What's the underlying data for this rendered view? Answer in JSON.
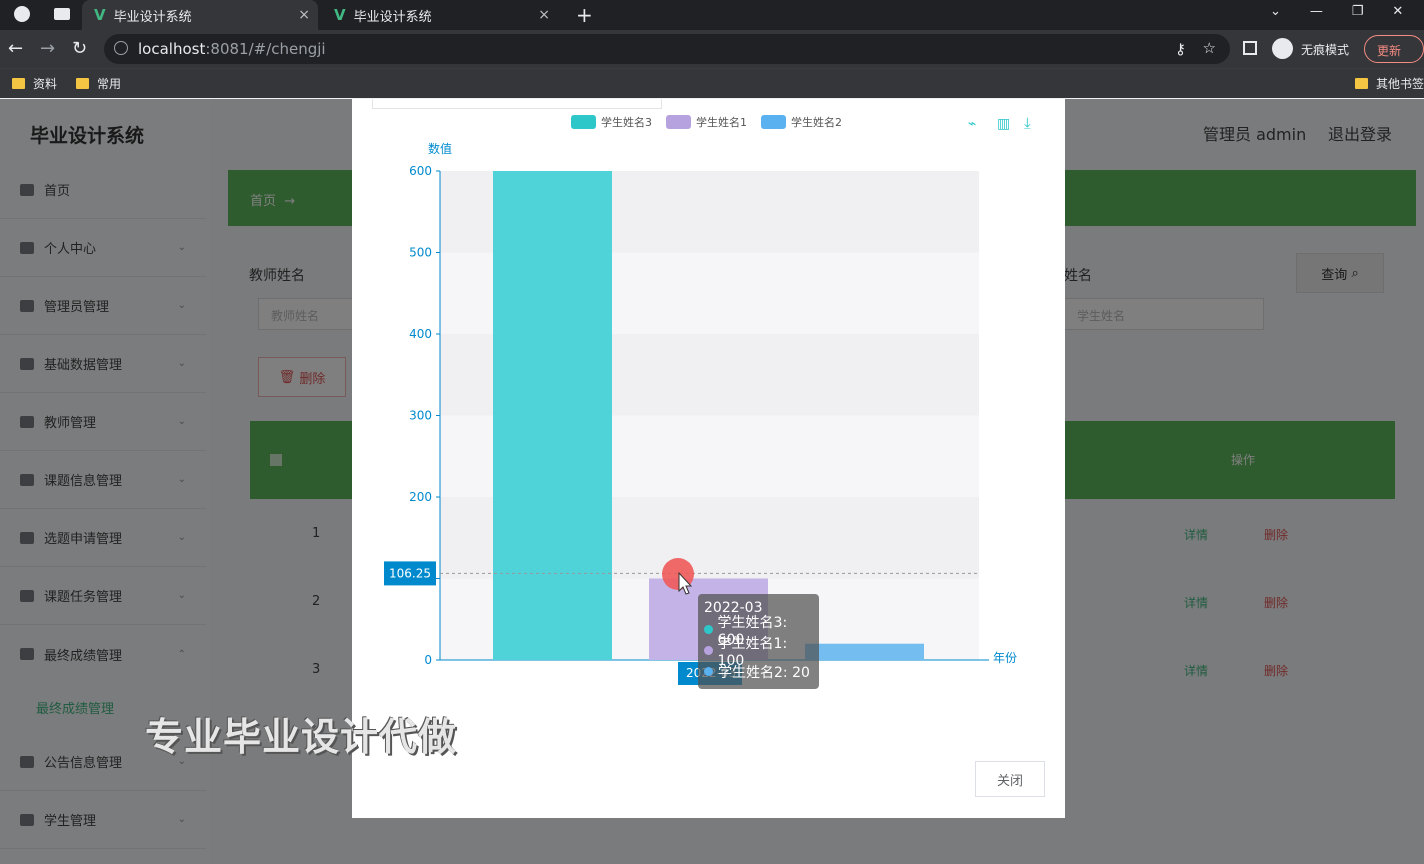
{
  "browser": {
    "tabs": [
      {
        "title": "毕业设计系统",
        "close": "×"
      },
      {
        "title": "毕业设计系统",
        "close": "×"
      }
    ],
    "new_tab": "+",
    "url_host": "localhost",
    "url_rest": ":8081/#/chengji",
    "incognito_label": "无痕模式",
    "update_label": "更新",
    "bookmarks": [
      "资料",
      "常用"
    ],
    "other_bookmarks": "其他书签"
  },
  "app": {
    "brand": "毕业设计系统",
    "user": "管理员 admin",
    "logout": "退出登录",
    "menu": [
      "首页",
      "个人中心",
      "管理员管理",
      "基础数据管理",
      "教师管理",
      "课题信息管理",
      "选题申请管理",
      "课题任务管理",
      "最终成绩管理",
      "公告信息管理",
      "学生管理"
    ],
    "submenu": "最终成绩管理",
    "breadcrumb": "首页",
    "search_label_teacher": "教师姓名",
    "search_placeholder_teacher": "教师姓名",
    "search_label_student": "姓名",
    "search_placeholder_student": "学生姓名",
    "query_button": "查询",
    "delete_button": "删除",
    "table_head_op": "操作",
    "rows": [
      {
        "num": "1",
        "detail": "详情",
        "delete": "删除"
      },
      {
        "num": "2",
        "detail": "详情",
        "delete": "删除"
      },
      {
        "num": "3",
        "detail": "详情",
        "delete": "删除"
      }
    ]
  },
  "modal": {
    "close_button": "关闭",
    "tooltip": {
      "title": "2022-03",
      "rows": [
        {
          "label": "学生姓名3: 600",
          "color": "#2ec7c9"
        },
        {
          "label": "学生姓名1: 100",
          "color": "#b6a2de"
        },
        {
          "label": "学生姓名2: 20",
          "color": "#5ab1ef"
        }
      ]
    },
    "axis_pointer_label": "106.25",
    "x_axis_pointer_label": "2022-03"
  },
  "chart_data": {
    "type": "bar",
    "categories": [
      "2022-03"
    ],
    "series": [
      {
        "name": "学生姓名3",
        "values": [
          600
        ],
        "color": "#4fd3d8"
      },
      {
        "name": "学生姓名1",
        "values": [
          100
        ],
        "color": "#c4b3e6"
      },
      {
        "name": "学生姓名2",
        "values": [
          20
        ],
        "color": "#74bdf0"
      }
    ],
    "xlabel": "年份",
    "ylabel": "数值",
    "ylim": [
      0,
      600
    ],
    "yticks": [
      0,
      100,
      200,
      300,
      400,
      500,
      600
    ],
    "ytick_labels": [
      "0",
      "",
      "200",
      "300",
      "400",
      "500",
      "600"
    ],
    "legend_position": "top",
    "grid": true
  },
  "watermark": "专业毕业设计代做"
}
